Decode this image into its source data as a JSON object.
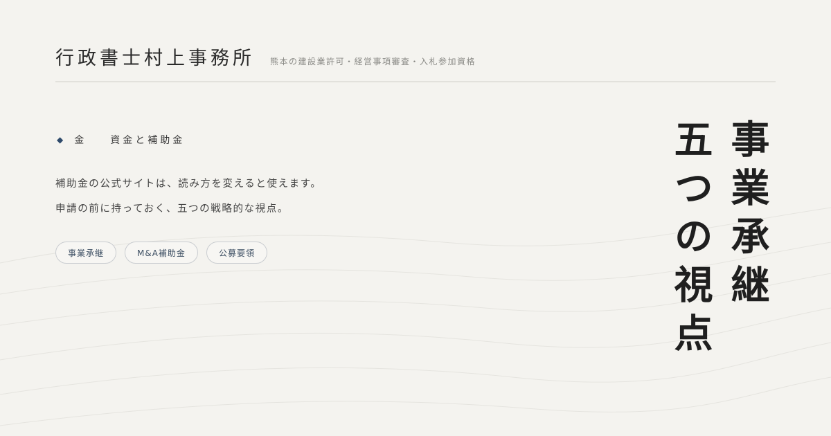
{
  "header": {
    "site_name": "行政書士村上事務所",
    "tagline": "熊本の建設業許可・経営事項審査・入札参加資格"
  },
  "category": {
    "icon": "diamond-icon",
    "main": "金",
    "sub": "資金と補助金"
  },
  "lead": {
    "line1": "補助金の公式サイトは、読み方を変えると使えます。",
    "line2": "申請の前に持っておく、五つの戦略的な視点。"
  },
  "tags": [
    {
      "label": "事業承継"
    },
    {
      "label": "M&A補助金"
    },
    {
      "label": "公募要領"
    }
  ],
  "title": {
    "line1": "事業承継",
    "line2": "五つの視点"
  },
  "colors": {
    "background": "#f4f3ef",
    "accent": "#2e4a6b",
    "text": "#2a2a2a"
  }
}
